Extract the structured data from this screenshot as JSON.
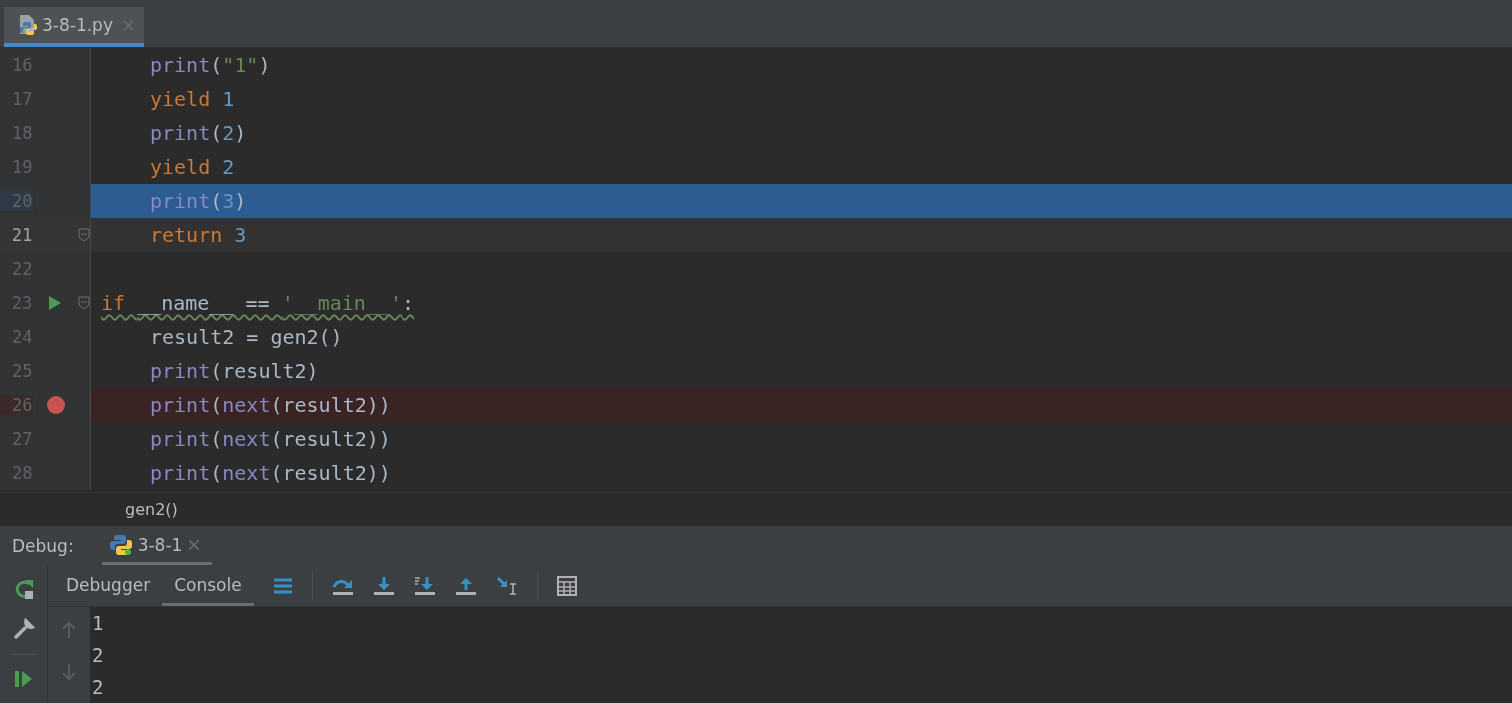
{
  "editor_tabs": [
    {
      "label": "3-8-1.py",
      "selected": true
    }
  ],
  "code_lines": [
    {
      "number": "16",
      "indented": true,
      "tokens": [
        {
          "kind": "builtin",
          "text": "print"
        },
        {
          "kind": "plain",
          "text": "("
        },
        {
          "kind": "string",
          "text": "\"1\""
        },
        {
          "kind": "plain",
          "text": ")"
        }
      ]
    },
    {
      "number": "17",
      "indented": true,
      "tokens": [
        {
          "kind": "keyword",
          "text": "yield "
        },
        {
          "kind": "number",
          "text": "1"
        }
      ]
    },
    {
      "number": "18",
      "indented": true,
      "tokens": [
        {
          "kind": "builtin",
          "text": "print"
        },
        {
          "kind": "plain",
          "text": "("
        },
        {
          "kind": "number",
          "text": "2"
        },
        {
          "kind": "plain",
          "text": ")"
        }
      ]
    },
    {
      "number": "19",
      "indented": true,
      "tokens": [
        {
          "kind": "keyword",
          "text": "yield "
        },
        {
          "kind": "number",
          "text": "2"
        }
      ]
    },
    {
      "number": "20",
      "indented": true,
      "current": true,
      "tokens": [
        {
          "kind": "builtin",
          "text": "print"
        },
        {
          "kind": "plain",
          "text": "("
        },
        {
          "kind": "number",
          "text": "3"
        },
        {
          "kind": "plain",
          "text": ")"
        }
      ]
    },
    {
      "number": "21",
      "indented": true,
      "caret": true,
      "fold": true,
      "tokens": [
        {
          "kind": "keyword",
          "text": "return "
        },
        {
          "kind": "number",
          "text": "3"
        }
      ]
    },
    {
      "number": "22"
    },
    {
      "number": "23",
      "indented": false,
      "run_marker": true,
      "fold": true,
      "warning": true,
      "tokens": [
        {
          "kind": "keyword",
          "text": "if "
        },
        {
          "kind": "plain",
          "text": "__name__ == "
        },
        {
          "kind": "string",
          "text": "'__main__'"
        },
        {
          "kind": "plain",
          "text": ":"
        }
      ]
    },
    {
      "number": "24",
      "indented": true,
      "tokens": [
        {
          "kind": "plain",
          "text": "result2 = gen2()"
        }
      ]
    },
    {
      "number": "25",
      "indented": true,
      "tokens": [
        {
          "kind": "builtin",
          "text": "print"
        },
        {
          "kind": "plain",
          "text": "(result2)"
        }
      ]
    },
    {
      "number": "26",
      "indented": true,
      "breakpoint": true,
      "tokens": [
        {
          "kind": "builtin",
          "text": "print"
        },
        {
          "kind": "plain",
          "text": "("
        },
        {
          "kind": "builtin",
          "text": "next"
        },
        {
          "kind": "plain",
          "text": "(result2))"
        }
      ]
    },
    {
      "number": "27",
      "indented": true,
      "tokens": [
        {
          "kind": "builtin",
          "text": "print"
        },
        {
          "kind": "plain",
          "text": "("
        },
        {
          "kind": "builtin",
          "text": "next"
        },
        {
          "kind": "plain",
          "text": "(result2))"
        }
      ]
    },
    {
      "number": "28",
      "indented": true,
      "tokens": [
        {
          "kind": "builtin",
          "text": "print"
        },
        {
          "kind": "plain",
          "text": "("
        },
        {
          "kind": "builtin",
          "text": "next"
        },
        {
          "kind": "plain",
          "text": "(result2))"
        }
      ]
    }
  ],
  "breadcrumb": "gen2()",
  "debug_panel": {
    "label": "Debug:",
    "session_tabs": [
      {
        "label": "3-8-1",
        "selected": true
      }
    ],
    "view_tabs": [
      {
        "label": "Debugger",
        "selected": false
      },
      {
        "label": "Console",
        "selected": true
      }
    ],
    "console_lines": [
      "1",
      "2",
      "2"
    ]
  }
}
